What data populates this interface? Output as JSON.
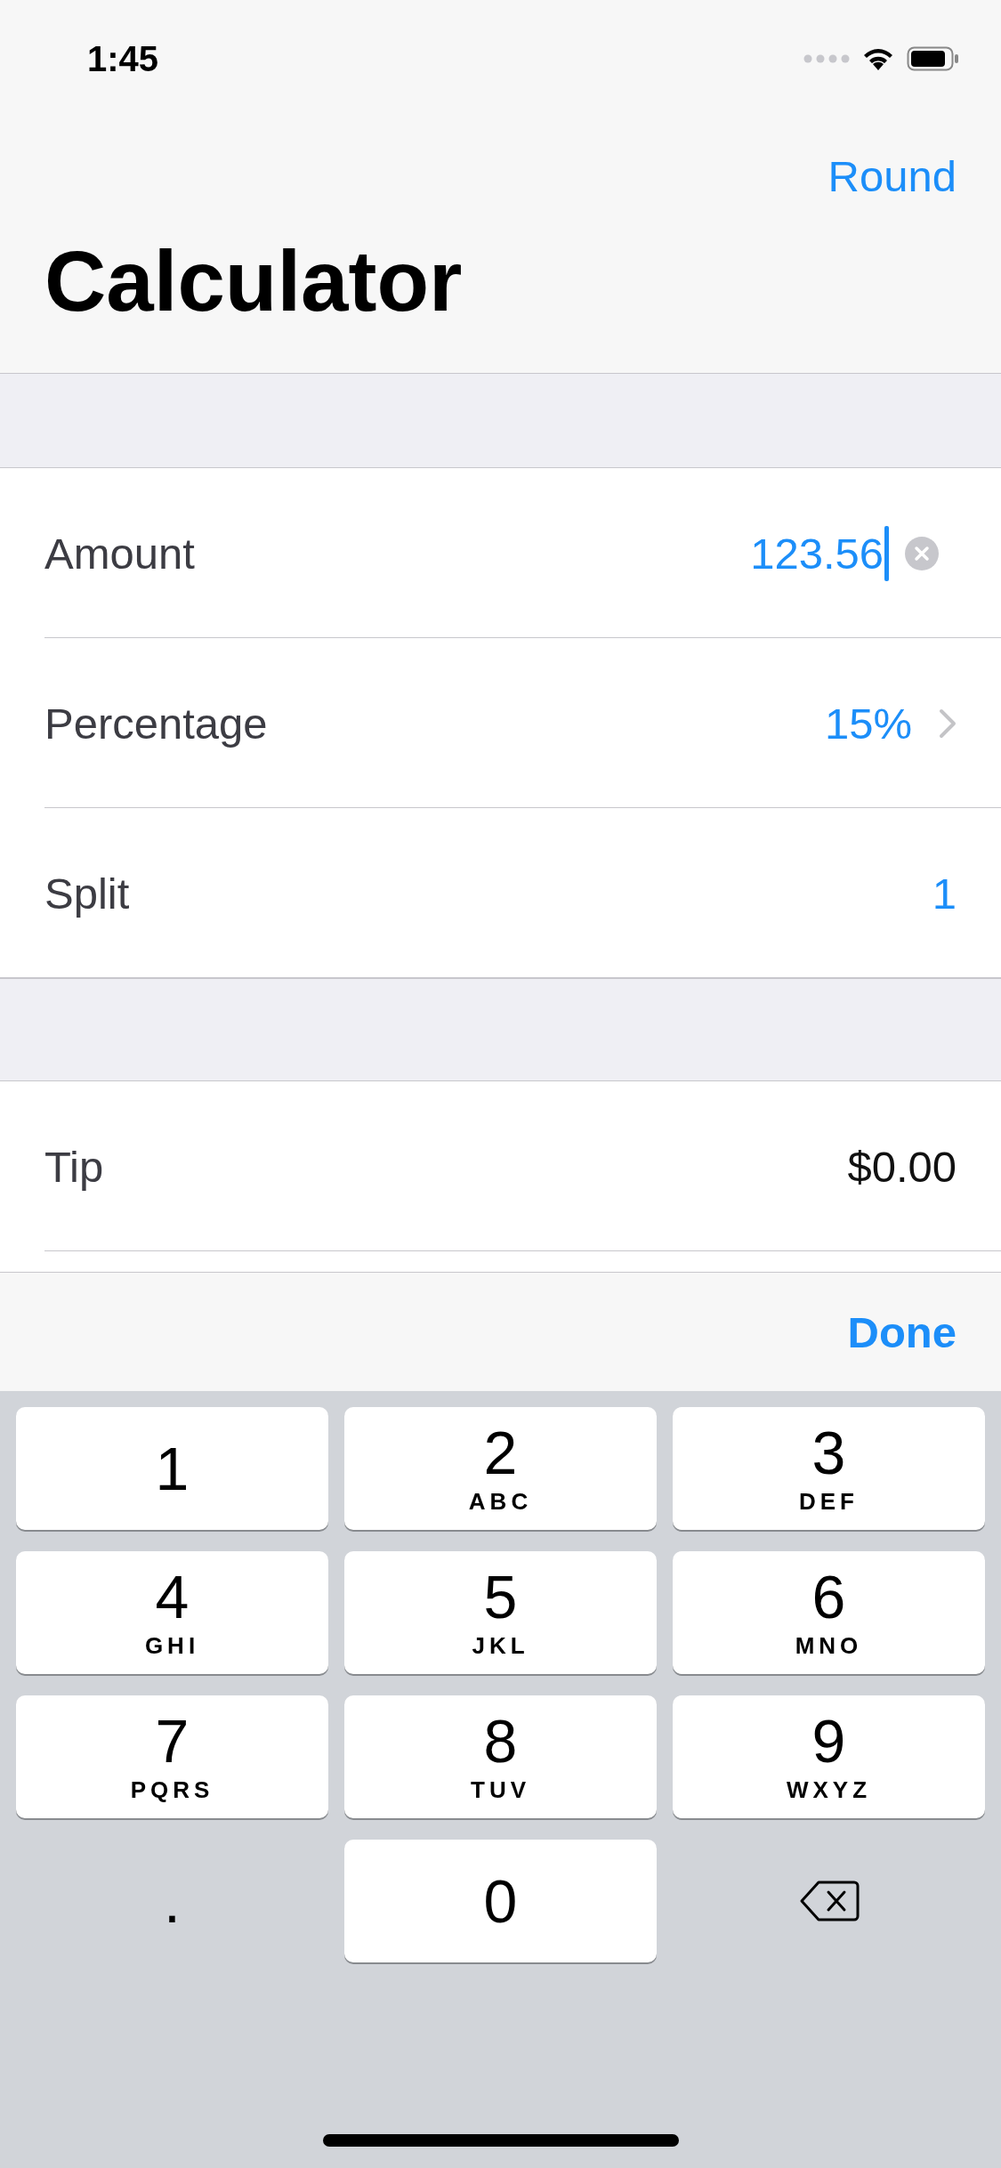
{
  "status_bar": {
    "time": "1:45"
  },
  "nav": {
    "button": "Round",
    "title": "Calculator"
  },
  "input_rows": [
    {
      "kind": "field",
      "label": "Amount",
      "value": "123.56",
      "focused": true
    },
    {
      "kind": "disclosure",
      "label": "Percentage",
      "value": "15%"
    },
    {
      "kind": "value",
      "label": "Split",
      "value": "1"
    }
  ],
  "result_rows": [
    {
      "label": "Tip",
      "value": "$0.00"
    }
  ],
  "toolbar": {
    "button": "Done"
  },
  "keyboard": [
    {
      "kind": "digit",
      "digit": "1"
    },
    {
      "kind": "digit",
      "digit": "2",
      "letters": "ABC"
    },
    {
      "kind": "digit",
      "digit": "3",
      "letters": "DEF"
    },
    {
      "kind": "digit",
      "digit": "4",
      "letters": "GHI"
    },
    {
      "kind": "digit",
      "digit": "5",
      "letters": "JKL"
    },
    {
      "kind": "digit",
      "digit": "6",
      "letters": "MNO"
    },
    {
      "kind": "digit",
      "digit": "7",
      "letters": "PQRS"
    },
    {
      "kind": "digit",
      "digit": "8",
      "letters": "TUV"
    },
    {
      "kind": "digit",
      "digit": "9",
      "letters": "WXYZ"
    },
    {
      "kind": "plain",
      "digit": "."
    },
    {
      "kind": "digit",
      "digit": "0"
    },
    {
      "kind": "delete"
    }
  ]
}
